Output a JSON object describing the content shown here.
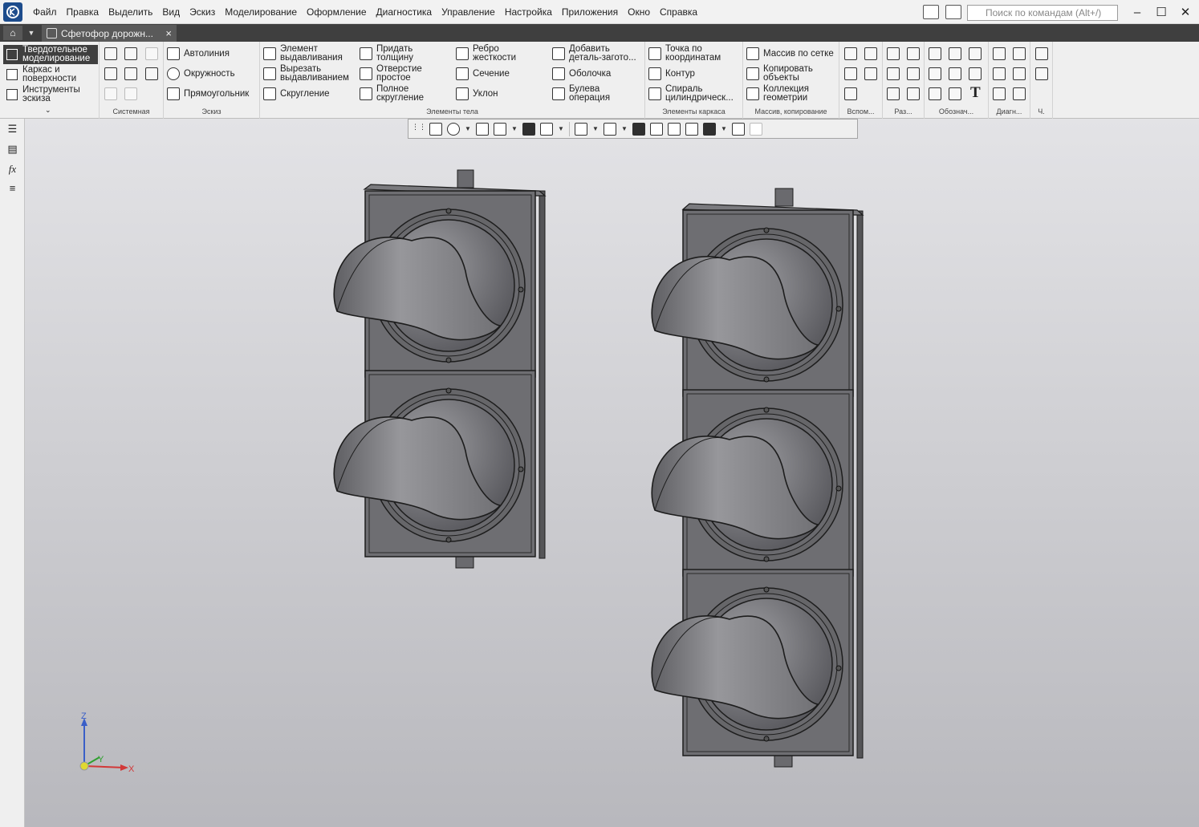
{
  "titlebar": {
    "menu": [
      "Файл",
      "Правка",
      "Выделить",
      "Вид",
      "Эскиз",
      "Моделирование",
      "Оформление",
      "Диагностика",
      "Управление",
      "Настройка",
      "Приложения",
      "Окно",
      "Справка"
    ],
    "search_placeholder": "Поиск по командам (Alt+/)"
  },
  "tabs": {
    "document": "Сфетофор дорожн..."
  },
  "ribbon": {
    "modes": [
      "Твердотельное моделирование",
      "Каркас и поверхности",
      "Инструменты эскиза"
    ],
    "groups": {
      "system": "Системная",
      "sketch": "Эскиз",
      "body": "Элементы тела",
      "frame": "Элементы каркаса",
      "array": "Массив, копирование",
      "aux": "Вспом...",
      "dims": "Раз...",
      "notation": "Обознач...",
      "diag": "Диагн...",
      "part": "Ч."
    },
    "sketch_tools": [
      "Автолиния",
      "Окружность",
      "Прямоугольник"
    ],
    "body_col1": [
      "Элемент выдавливания",
      "Вырезать выдавливанием",
      "Скругление"
    ],
    "body_col2": [
      "Придать толщину",
      "Отверстие простое",
      "Полное скругление"
    ],
    "body_col3": [
      "Ребро жесткости",
      "Сечение",
      "Уклон"
    ],
    "body_col4": [
      "Добавить деталь-загото...",
      "Оболочка",
      "Булева операция"
    ],
    "frame_tools": [
      "Точка по координатам",
      "Контур",
      "Спираль цилиндрическ..."
    ],
    "array_tools": [
      "Массив по сетке",
      "Копировать объекты",
      "Коллекция геометрии"
    ]
  },
  "axes": {
    "x": "X",
    "y": "Y",
    "z": "Z"
  }
}
